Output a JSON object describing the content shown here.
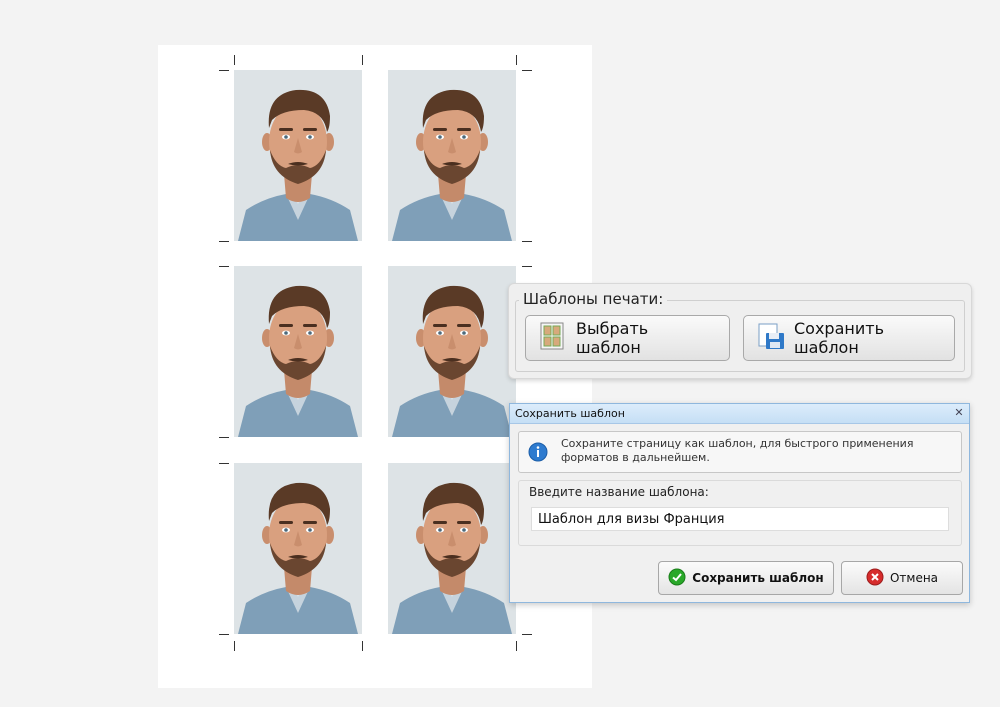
{
  "templates_panel": {
    "title": "Шаблоны печати:",
    "choose_label": "Выбрать шаблон",
    "save_label": "Сохранить шаблон"
  },
  "dialog": {
    "title": "Сохранить шаблон",
    "info_text": "Сохраните страницу как шаблон, для быстрого применения форматов в дальнейшем.",
    "name_label": "Введите название шаблона:",
    "name_value": "Шаблон для визы Франция",
    "save_label": "Сохранить шаблон",
    "cancel_label": "Отмена"
  },
  "photos": {
    "count": 6
  },
  "colors": {
    "photo_bg": "#dde3e6",
    "dialog_title_bg": "#c5dff5",
    "ok_green": "#29a829",
    "cancel_red": "#d62c2c",
    "info_blue": "#2e7bcf"
  }
}
